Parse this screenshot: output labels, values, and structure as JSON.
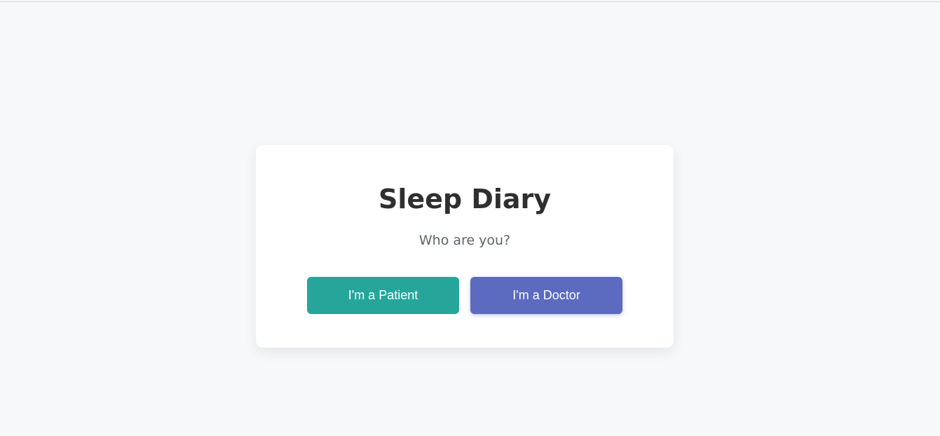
{
  "page": {
    "title": "Sleep Diary",
    "subtitle": "Who are you?"
  },
  "buttons": {
    "patient_label": "I'm a Patient",
    "doctor_label": "I'm a Doctor"
  },
  "colors": {
    "background": "#f7f8fa",
    "card": "#ffffff",
    "title_text": "#2f2f2f",
    "subtitle_text": "#5f6368",
    "patient_button": "#26a69a",
    "doctor_button": "#5c6bc0",
    "button_text": "#ffffff"
  }
}
